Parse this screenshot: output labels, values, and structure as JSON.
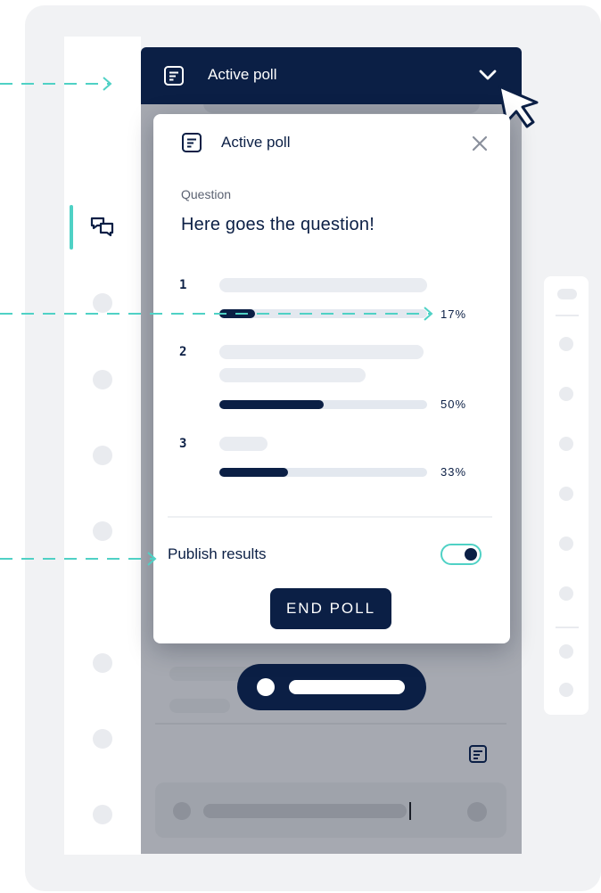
{
  "header": {
    "title": "Active poll"
  },
  "poll_modal": {
    "title": "Active poll",
    "question_label": "Question",
    "question_text": "Here goes the question!",
    "options": [
      {
        "number": "1",
        "percent_text": "17%",
        "fraction": 0.17
      },
      {
        "number": "2",
        "percent_text": "50%",
        "fraction": 0.5
      },
      {
        "number": "3",
        "percent_text": "33%",
        "fraction": 0.33
      }
    ],
    "publish_label": "Publish results",
    "publish_enabled": true,
    "end_button_label": "END POLL"
  },
  "colors": {
    "navy": "#0b1f45",
    "accent_teal": "#4fd1c5",
    "track": "#e3e8ef",
    "shade_overlay": "#a6a9b1"
  },
  "icons": {
    "header": "poll-icon",
    "collapse": "chevron-down-icon",
    "close": "close-icon",
    "rail": "chat-bubbles-icon"
  }
}
